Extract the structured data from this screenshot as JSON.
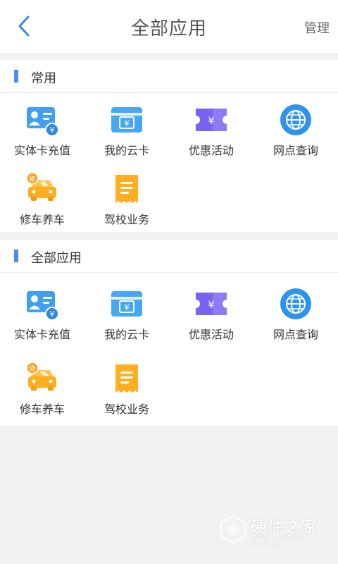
{
  "header": {
    "title": "全部应用",
    "manage_label": "管理"
  },
  "colors": {
    "accent": "#4b8bf4",
    "card_blue": "#3ea0ef",
    "coupon_purple": "#7a63f0",
    "globe_blue": "#2f93ea",
    "orange": "#ffae1f"
  },
  "sections": [
    {
      "title": "常用",
      "apps": [
        {
          "label": "实体卡充值",
          "icon": "card-recharge-icon"
        },
        {
          "label": "我的云卡",
          "icon": "cloud-card-icon"
        },
        {
          "label": "优惠活动",
          "icon": "coupon-icon"
        },
        {
          "label": "网点查询",
          "icon": "globe-icon"
        },
        {
          "label": "修车养车",
          "icon": "car-repair-icon"
        },
        {
          "label": "驾校业务",
          "icon": "receipt-icon"
        }
      ]
    },
    {
      "title": "全部应用",
      "apps": [
        {
          "label": "实体卡充值",
          "icon": "card-recharge-icon"
        },
        {
          "label": "我的云卡",
          "icon": "cloud-card-icon"
        },
        {
          "label": "优惠活动",
          "icon": "coupon-icon"
        },
        {
          "label": "网点查询",
          "icon": "globe-icon"
        },
        {
          "label": "修车养车",
          "icon": "car-repair-icon"
        },
        {
          "label": "驾校业务",
          "icon": "receipt-icon"
        }
      ]
    }
  ],
  "icon_text": {
    "yen": "¥",
    "repair": "修"
  },
  "watermark": {
    "name": "硬件之家",
    "sub": "YING JIAN ZHI JIA.COM"
  }
}
